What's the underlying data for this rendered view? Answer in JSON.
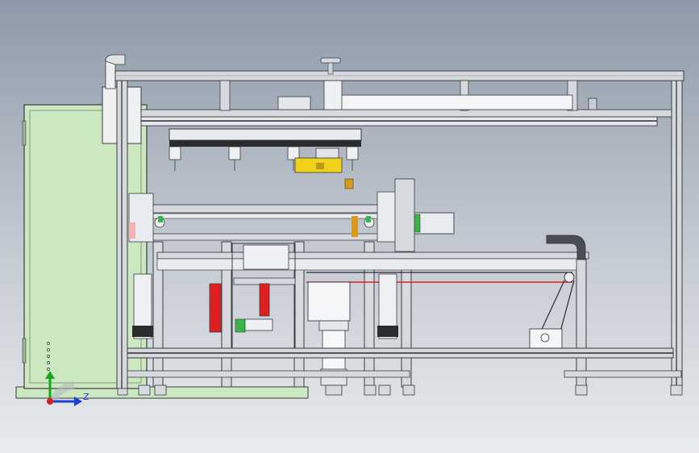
{
  "viewport": {
    "background_top": "#8e9aa9",
    "background_bottom": "#e9ebed"
  },
  "colors": {
    "cabinet": "#cbe8c0",
    "frame_profile": "#d6dade",
    "frame_edge": "#3a3d40",
    "dark_profile": "#2a2c2e",
    "red_part": "#e02020",
    "orange_part": "#d89a18",
    "yellow_part": "#f1d21a",
    "green_part": "#3bb54a",
    "axis_z": "#1c3fd8",
    "axis_y": "#1aa81a",
    "origin": "#d81c1c"
  },
  "triad": {
    "z_label": "Z",
    "icons": [
      "axis-z-arrow",
      "axis-y-arrow",
      "origin-dot"
    ]
  }
}
